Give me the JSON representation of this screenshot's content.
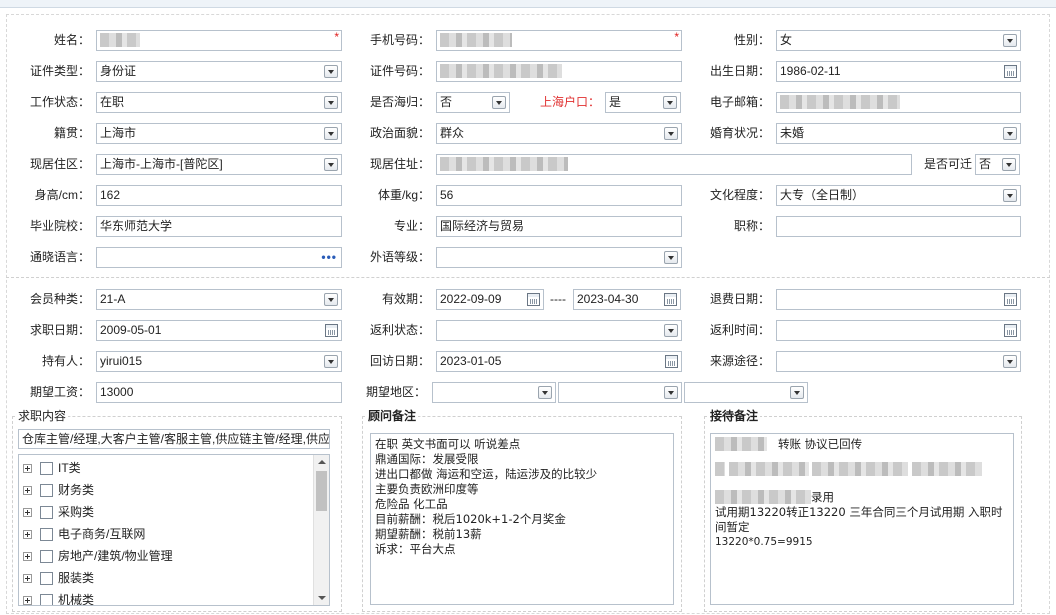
{
  "personal": {
    "name_label": "姓名：",
    "phone_label": "手机号码：",
    "gender_label": "性别：",
    "gender_value": "女",
    "idtype_label": "证件类型：",
    "idtype_value": "身份证",
    "idno_label": "证件号码：",
    "birth_label": "出生日期：",
    "birth_value": "1986-02-11",
    "work_label": "工作状态：",
    "work_value": "在职",
    "returnee_label": "是否海归：",
    "returnee_value": "否",
    "hukou_label": "上海户口：",
    "hukou_value": "是",
    "email_label": "电子邮箱：",
    "native_label": "籍贯：",
    "native_value": "上海市",
    "political_label": "政治面貌：",
    "political_value": "群众",
    "marital_label": "婚育状况：",
    "marital_value": "未婚",
    "residence_label": "现居住区：",
    "residence_value": "上海市-上海市-[普陀区]",
    "address_label": "现居住址：",
    "relocate_label": "是否可迁",
    "relocate_value": "否",
    "height_label": "身高/cm：",
    "height_value": "162",
    "weight_label": "体重/kg：",
    "weight_value": "56",
    "education_label": "文化程度：",
    "education_value": "大专（全日制）",
    "school_label": "毕业院校：",
    "school_value": "华东师范大学",
    "major_label": "专业：",
    "major_value": "国际经济与贸易",
    "title_label": "职称：",
    "title_value": "",
    "language_label": "通晓语言：",
    "language_dots": "•••",
    "foreign_label": "外语等级：",
    "foreign_value": ""
  },
  "membership": {
    "type_label": "会员种类：",
    "type_value": "21-A",
    "valid_label": "有效期：",
    "valid_from": "2022-09-09",
    "valid_sep": "----",
    "valid_to": "2023-04-30",
    "refund_label": "退费日期：",
    "refund_value": "",
    "job_date_label": "求职日期：",
    "job_date_value": "2009-05-01",
    "rebate_status_label": "返利状态：",
    "rebate_status_value": "",
    "rebate_time_label": "返利时间：",
    "rebate_time_value": "",
    "holder_label": "持有人：",
    "holder_value": "yirui015",
    "visit_label": "回访日期：",
    "visit_value": "2023-01-05",
    "source_label": "来源途径：",
    "source_value": "",
    "salary_label": "期望工资：",
    "salary_value": "13000",
    "region_label": "期望地区："
  },
  "job_content": {
    "title": "求职内容",
    "summary": "仓库主管/经理,大客户主管/客服主管,供应链主管/经理,供应",
    "categories": [
      "IT类",
      "财务类",
      "采购类",
      "电子商务/互联网",
      "房地产/建筑/物业管理",
      "服装类",
      "机械类"
    ]
  },
  "advisor": {
    "title": "顾问备注",
    "lines": [
      "在职  英文书面可以 听说差点",
      "鼎通国际：发展受限",
      "进出口都做 海运和空运，陆运涉及的比较少",
      "主要负责欧洲印度等",
      "危险品 化工品",
      "目前薪酬：税后1020k+1-2个月奖金",
      "期望薪酬：税前13薪",
      "诉求：平台大点"
    ]
  },
  "reception": {
    "title": "接待备注",
    "line1": "转账 协议已回传",
    "line2": "录用",
    "line3": "试用期13220转正13220 三年合同三个月试用期 入职时",
    "line4": "间暂定",
    "line5": "13220*0.75=9915"
  },
  "colors": {
    "border": "#b7c1cc",
    "required": "#e02020",
    "hukou_label": "#e03030"
  }
}
